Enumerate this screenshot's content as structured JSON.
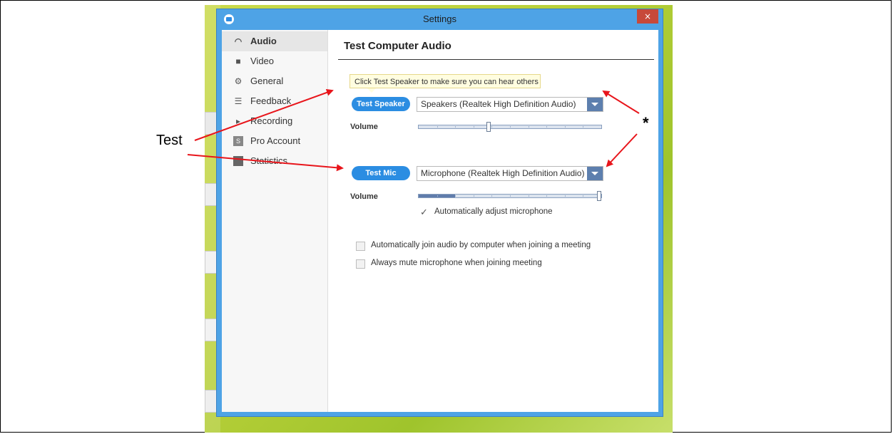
{
  "window": {
    "title": "Settings",
    "close_label": "×"
  },
  "sidebar": {
    "items": [
      {
        "label": "Audio",
        "icon": "headphones-icon",
        "glyph": "◠",
        "active": true
      },
      {
        "label": "Video",
        "icon": "video-camera-icon",
        "glyph": "■",
        "active": false
      },
      {
        "label": "General",
        "icon": "gears-icon",
        "glyph": "⚙",
        "active": false
      },
      {
        "label": "Feedback",
        "icon": "speech-bubble-icon",
        "glyph": "☰",
        "active": false
      },
      {
        "label": "Recording",
        "icon": "play-box-icon",
        "glyph": "▸",
        "active": false
      },
      {
        "label": "Pro Account",
        "icon": "pro-account-icon",
        "glyph": "S",
        "active": false
      },
      {
        "label": "Statistics",
        "icon": "statistics-icon",
        "glyph": "▪",
        "active": false
      }
    ]
  },
  "main": {
    "title": "Test Computer Audio",
    "tooltip": "Click Test Speaker to make sure you can hear others",
    "speaker": {
      "button_label": "Test Speaker",
      "device": "Speakers (Realtek High Definition Audio)",
      "volume_label": "Volume",
      "volume_level": 0.38
    },
    "mic": {
      "button_label": "Test Mic",
      "device": "Microphone (Realtek High Definition Audio)",
      "volume_label": "Volume",
      "volume_level": 1.0,
      "input_level": 0.2,
      "auto_adjust_label": "Automatically adjust microphone",
      "auto_adjust_checked": true
    },
    "options": [
      {
        "label": "Automatically join audio by computer when joining a meeting",
        "checked": false
      },
      {
        "label": "Always mute microphone when joining meeting",
        "checked": false
      }
    ]
  },
  "annotations": {
    "test_label": "Test",
    "star_label": "*",
    "arrow_color": "#e8151b"
  },
  "colors": {
    "accent": "#2b8de2",
    "window_frame": "#4ea3e6",
    "close": "#c7493a"
  }
}
